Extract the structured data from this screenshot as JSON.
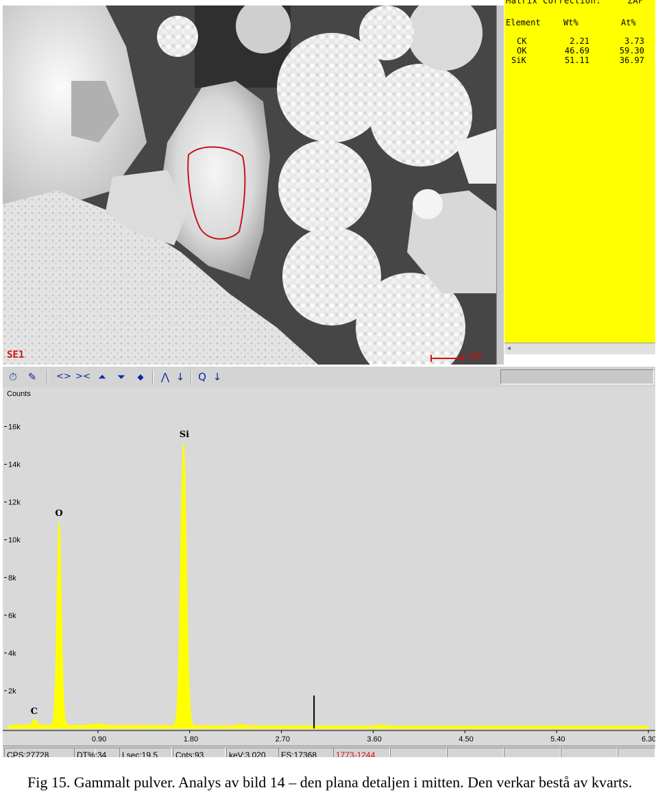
{
  "sem_image": {
    "detector_label": "SE1",
    "scale_label": "2µm"
  },
  "zaf": {
    "header_cut": "Matrix Correction:     ZAF",
    "columns": [
      "Element",
      "Wt%",
      "At%"
    ],
    "rows": [
      {
        "element": "CK",
        "wt": "2.21",
        "at": "3.73"
      },
      {
        "element": "OK",
        "wt": "46.69",
        "at": "59.30"
      },
      {
        "element": "SiK",
        "wt": "51.11",
        "at": "36.97"
      }
    ],
    "scroll_arrow": "◂"
  },
  "toolbar": {
    "icons": [
      "timer-icon",
      "pen-edit-icon",
      "expand-horizontal-icon",
      "contract-horizontal-icon",
      "scale-up-icon",
      "scale-down-icon",
      "marker-icon",
      "peak-label-icon",
      "arrow-down-icon",
      "peak-search-icon",
      "arrow-down-icon"
    ],
    "glyphs": [
      "⏱",
      "✎",
      "<>",
      "><",
      "⏶",
      "⏷",
      "◆",
      "⋀",
      "↓",
      "Q",
      "↓"
    ]
  },
  "chart_data": {
    "type": "area",
    "ylabel": "Counts",
    "y_ticks": [
      "16k",
      "14k",
      "12k",
      "10k",
      "8k",
      "6k",
      "4k",
      "2k"
    ],
    "x_ticks": [
      "0.90",
      "1.80",
      "2.70",
      "3.60",
      "4.50",
      "5.40",
      "6.30"
    ],
    "xlim": [
      0,
      6.3
    ],
    "ylim": [
      0,
      17000
    ],
    "color": "#ffff00",
    "peaks": [
      {
        "label": "C",
        "kev": 0.28,
        "counts": 300
      },
      {
        "label": "O",
        "kev": 0.52,
        "counts": 10800
      },
      {
        "label": "Si",
        "kev": 1.74,
        "counts": 15000
      }
    ],
    "cursor_kev": 3.02
  },
  "status": {
    "cps": "CPS:27728",
    "dt": "DT%:34",
    "lsec": "Lsec:19.5",
    "cnts": "Cnts:93",
    "kev": "keV:3.020",
    "fs": "FS:17368",
    "roi": "1773-1244"
  },
  "caption": {
    "text": "Fig 15. Gammalt pulver. Analys av bild 14 – den plana detaljen i mitten. Den verkar bestå av kvarts."
  }
}
